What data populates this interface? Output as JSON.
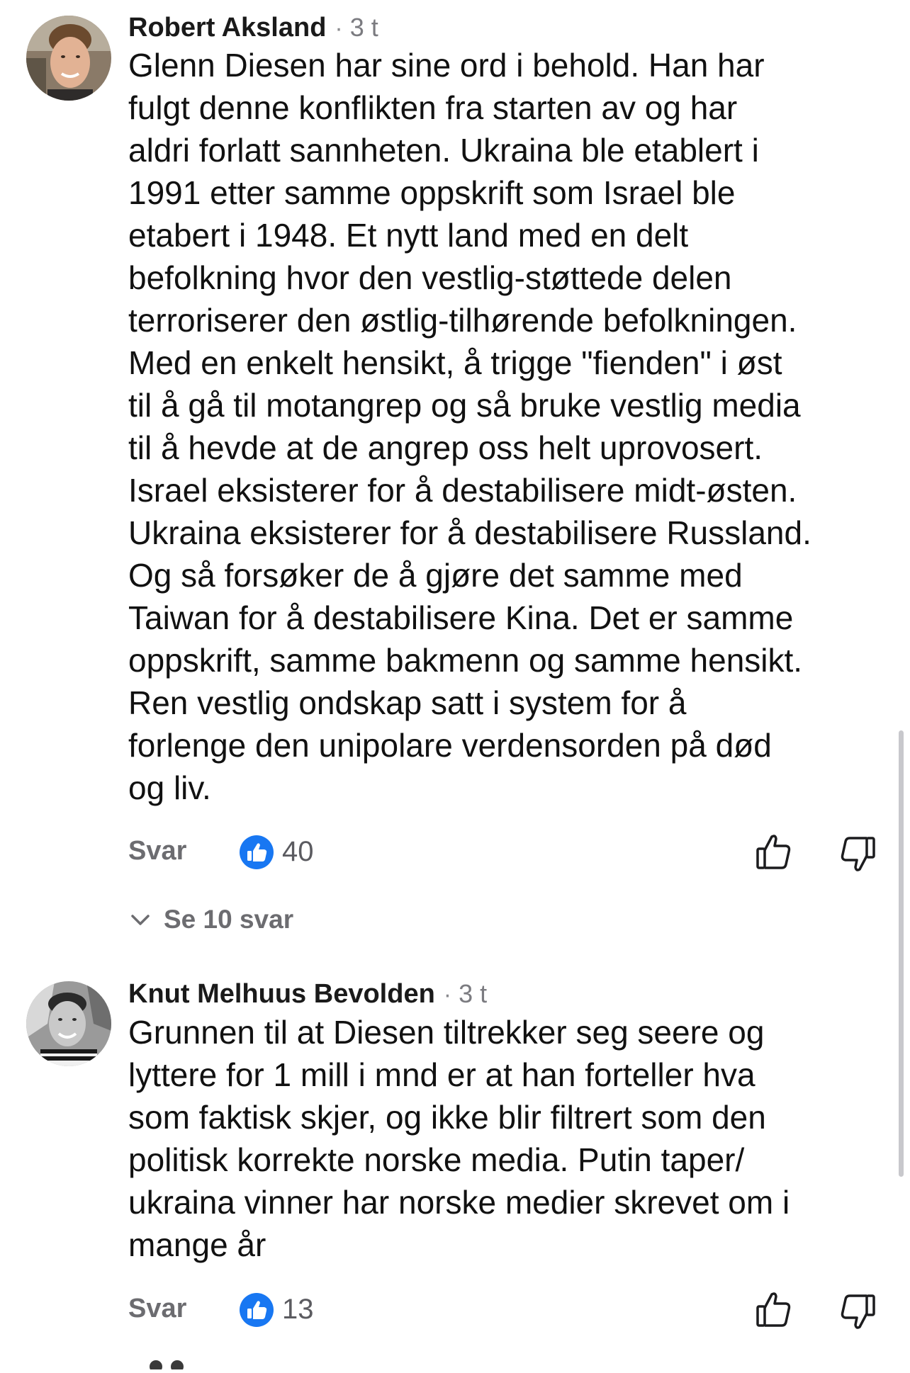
{
  "comments": [
    {
      "author": "Robert Aksland",
      "separator": "·",
      "time": "3 t",
      "text_lines": [
        "Glenn Diesen har sine ord i behold. Han har",
        "fulgt denne konflikten fra starten av og har",
        "aldri forlatt sannheten. Ukraina ble etablert i",
        "1991 etter samme oppskrift som Israel ble",
        "etabert i 1948. Et nytt land med en delt",
        "befolkning hvor den vestlig-støttede delen",
        "terroriserer den østlig-tilhørende befolkningen.",
        "Med en enkelt hensikt, å trigge \"fienden\" i øst",
        "til å gå til motangrep og så bruke vestlig media",
        "til å hevde at de angrep oss helt uprovosert.",
        "Israel eksisterer for å destabilisere midt-østen.",
        "Ukraina eksisterer for å destabilisere Russland.",
        "Og så forsøker de å gjøre det samme med",
        "Taiwan for å destabilisere Kina. Det er samme",
        "oppskrift, samme bakmenn og samme hensikt.",
        "Ren vestlig ondskap satt i system for å",
        "forlenge den unipolare verdensorden på død",
        "og liv."
      ],
      "reply_label": "Svar",
      "like_count": "40",
      "see_replies_label": "Se 10 svar"
    },
    {
      "author": "Knut Melhuus Bevolden",
      "separator": "·",
      "time": "3 t",
      "text_lines": [
        "Grunnen til at Diesen tiltrekker seg seere og",
        "lyttere for 1 mill i mnd er at han forteller hva",
        "som faktisk skjer, og ikke blir filtrert som den",
        "politisk korrekte norske media. Putin taper/",
        "ukraina vinner har norske medier skrevet om i",
        "mange år"
      ],
      "reply_label": "Svar",
      "like_count": "13"
    }
  ],
  "icons": {
    "like_badge": "like-reaction-icon",
    "thumbs_up": "thumbs-up-icon",
    "thumbs_down": "thumbs-down-icon",
    "chevron": "chevron-down-icon"
  },
  "colors": {
    "like_blue": "#1877f2",
    "secondary_text": "#6c6c70",
    "primary_text": "#111111"
  }
}
